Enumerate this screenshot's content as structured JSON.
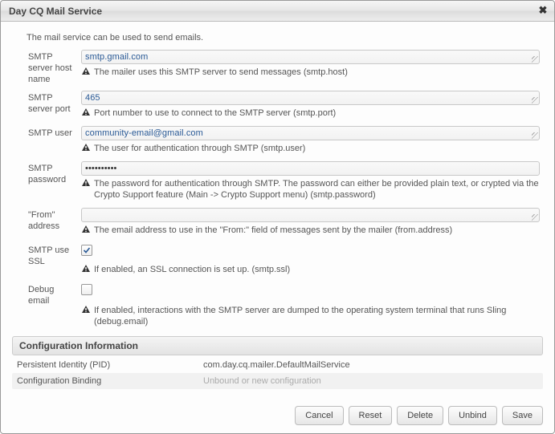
{
  "window": {
    "title": "Day CQ Mail Service",
    "close_icon": "✖"
  },
  "intro": "The mail service can be used to send emails.",
  "fields": {
    "host": {
      "label": "SMTP server host name",
      "value": "smtp.gmail.com",
      "hint": "The mailer uses this SMTP server to send messages (smtp.host)"
    },
    "port": {
      "label": "SMTP server port",
      "value": "465",
      "hint": "Port number to use to connect to the SMTP server (smtp.port)"
    },
    "user": {
      "label": "SMTP user",
      "value": "community-email@gmail.com",
      "hint": "The user for authentication through SMTP (smtp.user)"
    },
    "password": {
      "label": "SMTP password",
      "value": "••••••••••",
      "hint": "The password for authentication through SMTP. The password can either be provided plain text, or crypted via the Crypto Support feature (Main -> Crypto Support menu) (smtp.password)"
    },
    "from": {
      "label": "\"From\" address",
      "value": "",
      "hint": "The email address to use in the \"From:\" field of messages sent by the mailer (from.address)"
    },
    "ssl": {
      "label": "SMTP use SSL",
      "checked": true,
      "hint": "If enabled, an SSL connection is set up. (smtp.ssl)"
    },
    "debug": {
      "label": "Debug email",
      "checked": false,
      "hint": "If enabled, interactions with the SMTP server are dumped to the operating system terminal that runs Sling (debug.email)"
    }
  },
  "config_section": {
    "header": "Configuration Information",
    "pid_label": "Persistent Identity (PID)",
    "pid_value": "com.day.cq.mailer.DefaultMailService",
    "binding_label": "Configuration Binding",
    "binding_value": "Unbound or new configuration"
  },
  "buttons": {
    "cancel": "Cancel",
    "reset": "Reset",
    "delete": "Delete",
    "unbind": "Unbind",
    "save": "Save"
  }
}
